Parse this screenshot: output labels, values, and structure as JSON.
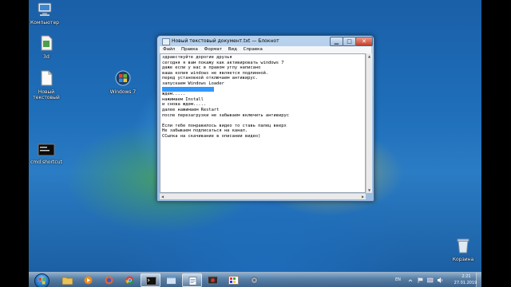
{
  "desktop": {
    "icons": [
      {
        "name": "computer",
        "label": "Компьютер"
      },
      {
        "name": "file1",
        "label": "3d"
      },
      {
        "name": "file2",
        "label": "Новый текстовый"
      },
      {
        "name": "windows7",
        "label": "Windows 7"
      },
      {
        "name": "cmd",
        "label": "cmd shortcut"
      },
      {
        "name": "trash",
        "label": "Корзина"
      }
    ]
  },
  "notepad": {
    "title": "Новый текстовый документ.txt — Блокнот",
    "menu": [
      "Файл",
      "Правка",
      "Формат",
      "Вид",
      "Справка"
    ],
    "lines": [
      "здравствуйте дорогие друзья",
      "сегодня я вам покажу как активировать windows 7",
      "даже если у вас в правом углу написано",
      "ваша копия windows не является подлинной.",
      "перед установкой отключаем антивирус.",
      "запускаем Windows Loader",
      "Windows Loader 2.2.2",
      "ждем.....",
      "нажимаем Install",
      "и снова ждем.....",
      "далее нажимаем Restart",
      "после перезагрузки не забываем включить антивирус",
      "",
      "Если тебе понравилось видео то ставь палец вверх",
      "Не забываем подписаться на канал.",
      "ССылка на скачивание в описании видео)"
    ],
    "selected_line_index": 6
  },
  "taskbar": {
    "language": "EN",
    "time": "2:21",
    "date": "27.01.2019"
  },
  "colors": {
    "selection": "#3399ff",
    "close_button": "#c2402a"
  }
}
